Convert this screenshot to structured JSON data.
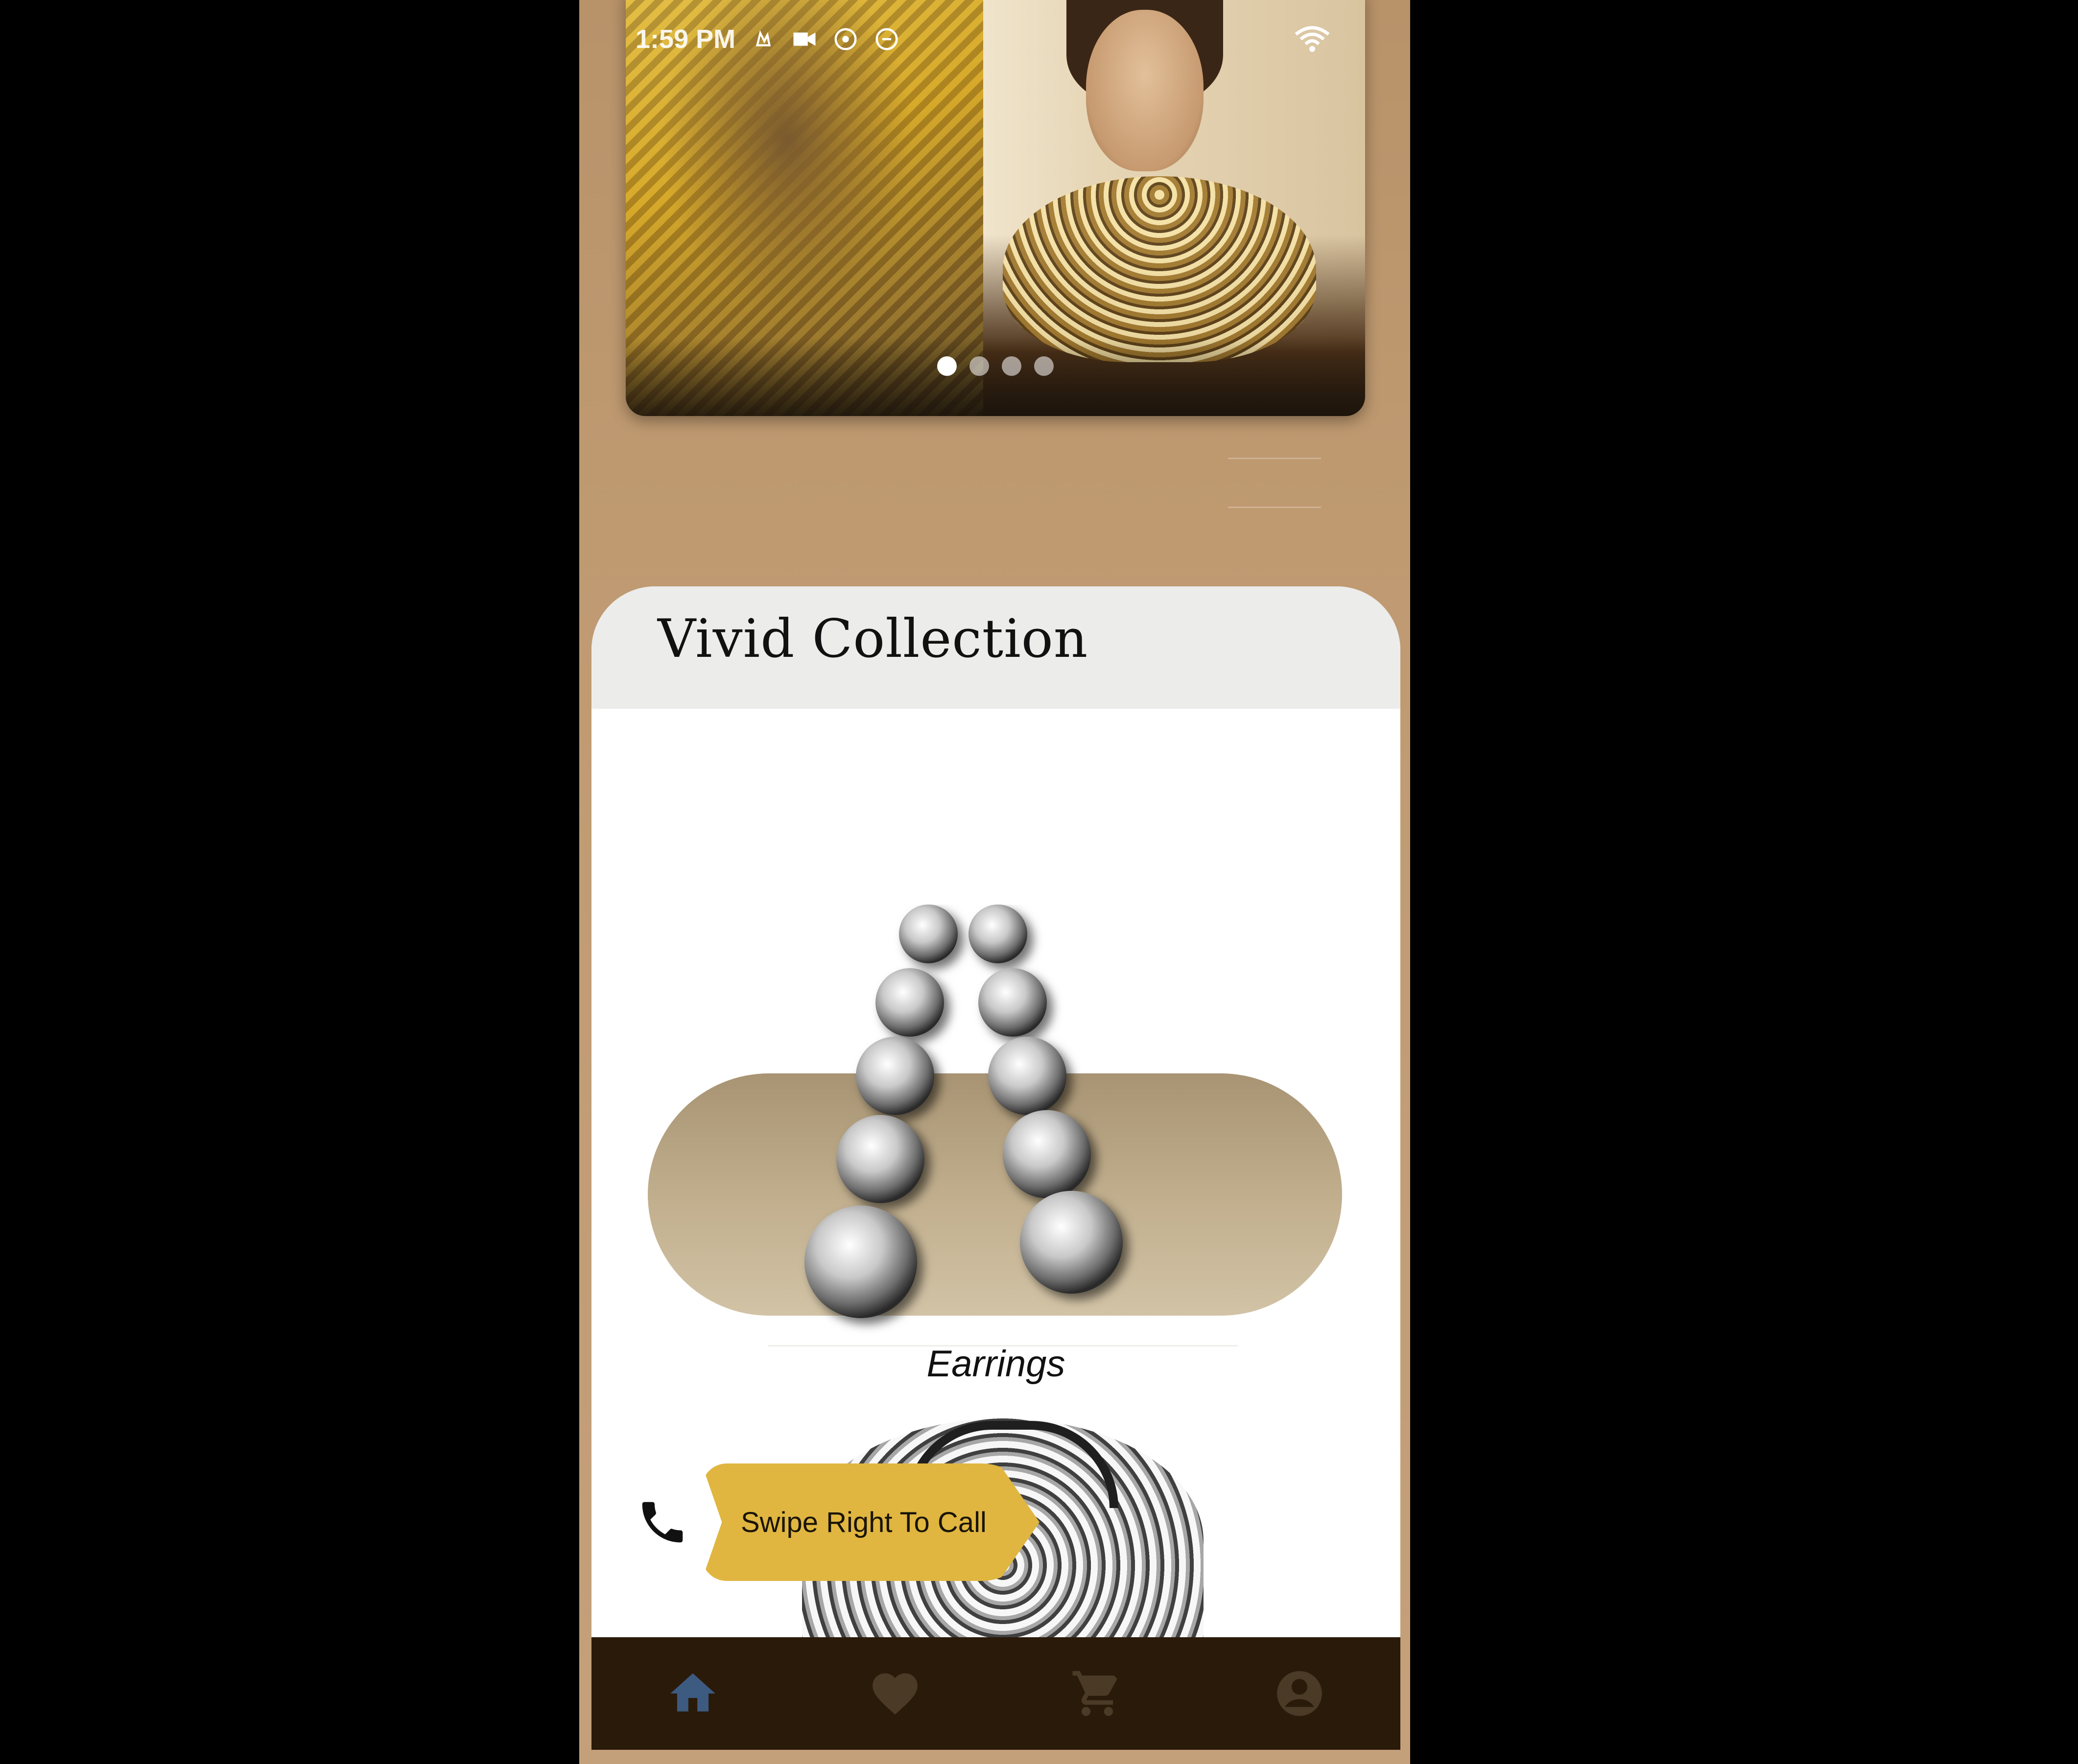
{
  "status_bar": {
    "time": "1:59 PM",
    "icons": [
      "notification-icon",
      "video-icon",
      "sync-icon",
      "data-saver-icon",
      "wifi-icon"
    ]
  },
  "banner": {
    "slide_count": 4,
    "active_index": 0
  },
  "collection": {
    "title": "Vivid Collection",
    "products": [
      {
        "name": "Earrings",
        "icon": "earrings-image"
      },
      {
        "name": "",
        "icon": "necklace-image"
      }
    ]
  },
  "call_action": {
    "label": "Swipe Right To Call",
    "icon": "phone-icon",
    "accent_color": "#e0b640"
  },
  "bottom_nav": {
    "items": [
      {
        "icon": "home-icon",
        "active": true
      },
      {
        "icon": "heart-icon",
        "active": false
      },
      {
        "icon": "cart-icon",
        "active": false
      },
      {
        "icon": "profile-icon",
        "active": false
      }
    ],
    "active_color": "#3d5a80",
    "inactive_color": "#4a3a26"
  },
  "colors": {
    "background": "#bf9a71",
    "card": "#ffffff",
    "card_header": "#ececeb",
    "nav_bar": "#2a1a09"
  }
}
